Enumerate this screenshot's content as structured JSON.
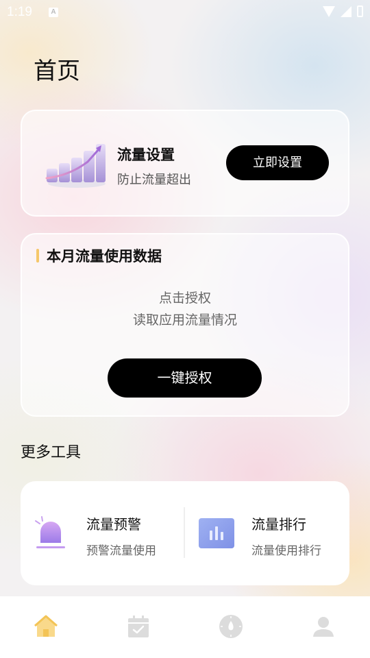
{
  "status_bar": {
    "time": "1:19",
    "notification_letter": "A"
  },
  "header": {
    "title": "首页"
  },
  "flow_setting": {
    "title": "流量设置",
    "subtitle": "防止流量超出",
    "button": "立即设置"
  },
  "monthly_data": {
    "title": "本月流量使用数据",
    "hint_line1": "点击授权",
    "hint_line2": "读取应用流量情况",
    "button": "一键授权"
  },
  "more_tools": {
    "title": "更多工具",
    "items": [
      {
        "name": "流量预警",
        "desc": "预警流量使用",
        "icon": "alarm-icon"
      },
      {
        "name": "流量排行",
        "desc": "流量使用排行",
        "icon": "bar-chart-icon"
      }
    ]
  },
  "bottom_nav": {
    "items": [
      {
        "icon": "home-icon",
        "active": true
      },
      {
        "icon": "calendar-check-icon",
        "active": false
      },
      {
        "icon": "compass-icon",
        "active": false
      },
      {
        "icon": "user-icon",
        "active": false
      }
    ]
  },
  "colors": {
    "accent": "#f5c76a",
    "button_bg": "#000000",
    "nav_inactive": "#d9d9d9"
  }
}
